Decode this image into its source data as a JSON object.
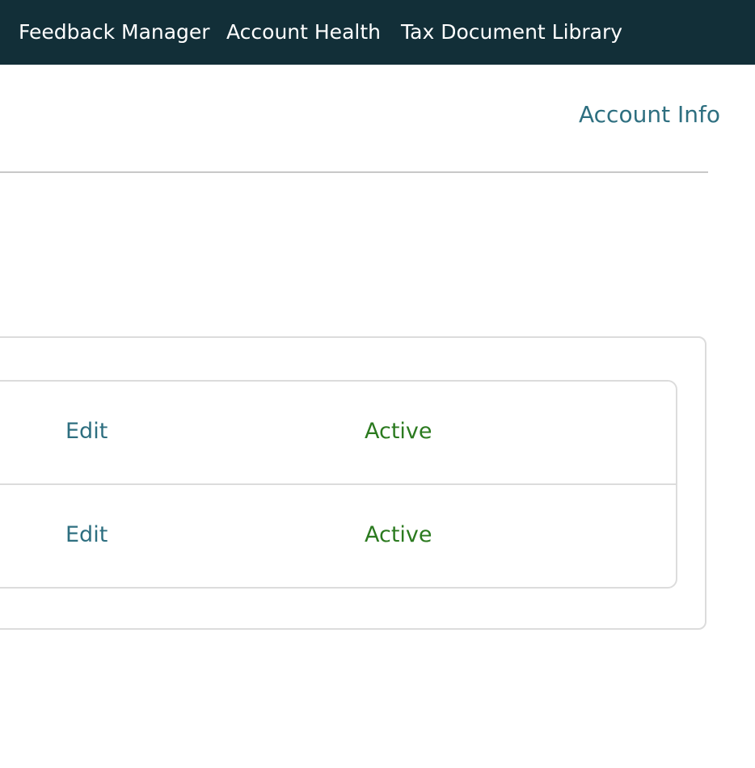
{
  "topnav": {
    "items": [
      {
        "label": "Feedback Manager"
      },
      {
        "label": "Account Health"
      },
      {
        "label": "Tax Document Library"
      }
    ]
  },
  "header": {
    "account_info": "Account Info"
  },
  "table": {
    "rows": [
      {
        "action": "Edit",
        "status": "Active"
      },
      {
        "action": "Edit",
        "status": "Active"
      }
    ]
  },
  "colors": {
    "nav_bg": "#122f38",
    "link": "#2e6f80",
    "status_active": "#2b7a1f",
    "border": "#dcdcdc"
  }
}
